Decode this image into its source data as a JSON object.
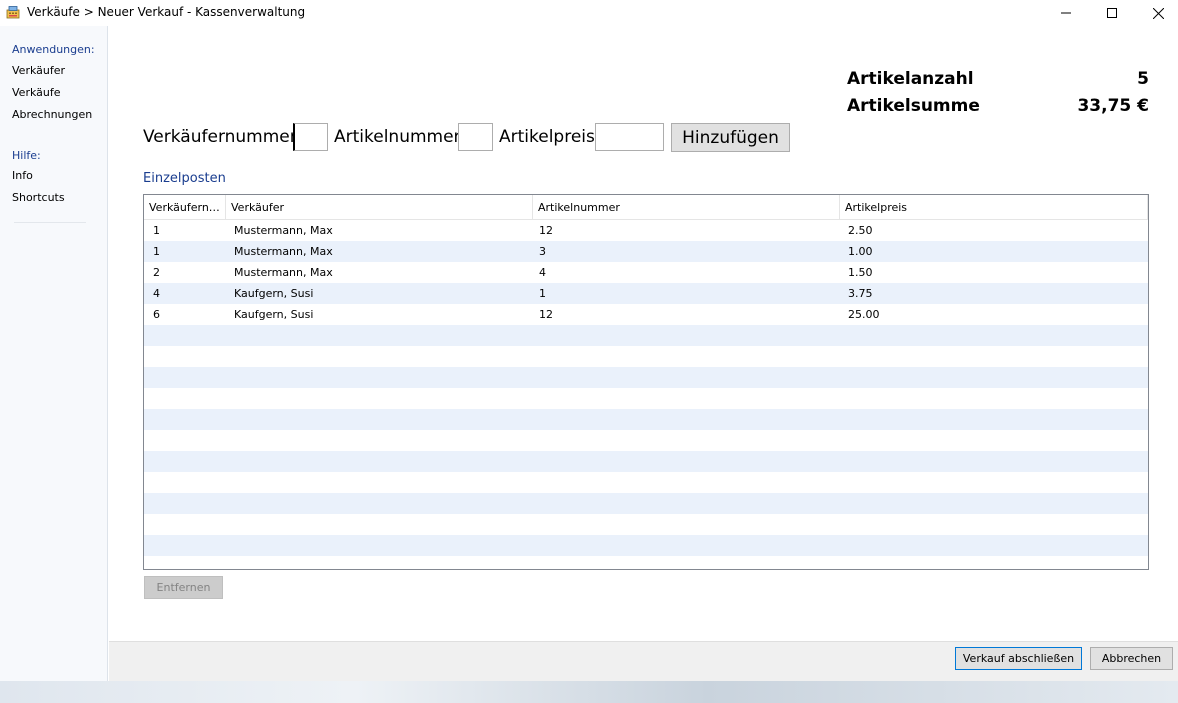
{
  "window": {
    "title": "Verkäufe > Neuer Verkauf - Kassenverwaltung",
    "icon": "cash-register-icon"
  },
  "sidebar": {
    "sections": [
      {
        "heading": "Anwendungen:",
        "items": [
          "Verkäufer",
          "Verkäufe",
          "Abrechnungen"
        ]
      },
      {
        "heading": "Hilfe:",
        "items": [
          "Info",
          "Shortcuts"
        ]
      }
    ]
  },
  "summary": {
    "count_label": "Artikelanzahl",
    "count_value": "5",
    "sum_label": "Artikelsumme",
    "sum_value": "33,75 €"
  },
  "form": {
    "seller_label": "Verkäufernummer:",
    "seller_value": "",
    "article_label": "Artikelnummer:",
    "article_value": "",
    "price_label": "Artikelpreis:",
    "price_value": "",
    "add_button": "Hinzufügen"
  },
  "items": {
    "title": "Einzelposten",
    "columns": [
      "Verkäufernu...",
      "Verkäufer",
      "Artikelnummer",
      "Artikelpreis"
    ],
    "rows": [
      [
        "1",
        "Mustermann, Max",
        "12",
        "2.50"
      ],
      [
        "1",
        "Mustermann, Max",
        "3",
        "1.00"
      ],
      [
        "2",
        "Mustermann, Max",
        "4",
        "1.50"
      ],
      [
        "4",
        "Kaufgern, Susi",
        "1",
        "3.75"
      ],
      [
        "6",
        "Kaufgern, Susi",
        "12",
        "25.00"
      ]
    ],
    "remove_button": "Entfernen"
  },
  "footer": {
    "finish_button": "Verkauf abschließen",
    "cancel_button": "Abbrechen"
  }
}
